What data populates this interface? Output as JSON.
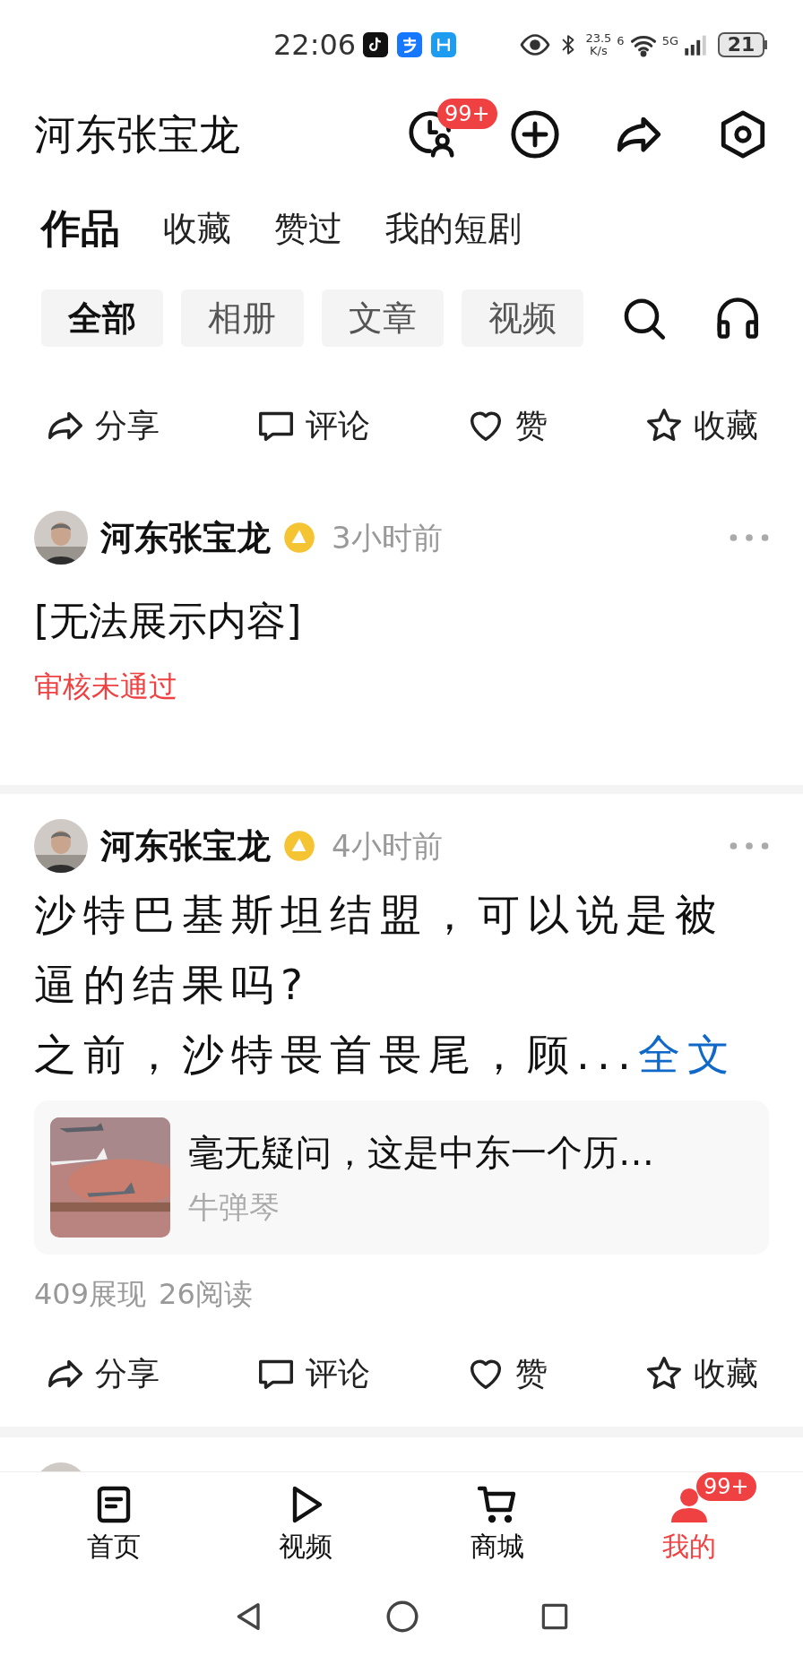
{
  "status_bar": {
    "time": "22:06",
    "speed": "23.5\nK/s",
    "wifi_label": "6",
    "network": "5G",
    "battery": "21"
  },
  "header": {
    "title": "河东张宝龙",
    "badge": "99+"
  },
  "tabs": [
    {
      "label": "作品",
      "selected": true
    },
    {
      "label": "收藏",
      "selected": false
    },
    {
      "label": "赞过",
      "selected": false
    },
    {
      "label": "我的短剧",
      "selected": false
    }
  ],
  "filters": [
    {
      "label": "全部",
      "selected": true
    },
    {
      "label": "相册",
      "selected": false
    },
    {
      "label": "文章",
      "selected": false
    },
    {
      "label": "视频",
      "selected": false
    }
  ],
  "top_actions": [
    {
      "kind": "share",
      "label": "分享"
    },
    {
      "kind": "comment",
      "label": "评论"
    },
    {
      "kind": "like",
      "label": "赞"
    },
    {
      "kind": "favorite",
      "label": "收藏"
    }
  ],
  "posts": [
    {
      "author": "河东张宝龙",
      "time": "3小时前",
      "text": "[无法展示内容]",
      "status": "审核未通过"
    },
    {
      "author": "河东张宝龙",
      "time": "4小时前",
      "title": "沙特巴基斯坦结盟，可以说是被逼的结果吗?",
      "excerpt": "之前，沙特畏首畏尾，顾...",
      "more": "全文",
      "card": {
        "title": "毫无疑问，这是中东一个历…",
        "source": "牛弹琴"
      },
      "stats": [
        "409展现",
        "26阅读"
      ],
      "actions": [
        {
          "kind": "share",
          "label": "分享"
        },
        {
          "kind": "comment",
          "label": "评论"
        },
        {
          "kind": "like",
          "label": "赞"
        },
        {
          "kind": "favorite",
          "label": "收藏"
        }
      ]
    }
  ],
  "bottom_nav": [
    {
      "kind": "home",
      "label": "首页",
      "selected": false
    },
    {
      "kind": "video",
      "label": "视频",
      "selected": false
    },
    {
      "kind": "mall",
      "label": "商城",
      "selected": false
    },
    {
      "kind": "me",
      "label": "我的",
      "selected": true,
      "badge": "99+"
    }
  ]
}
